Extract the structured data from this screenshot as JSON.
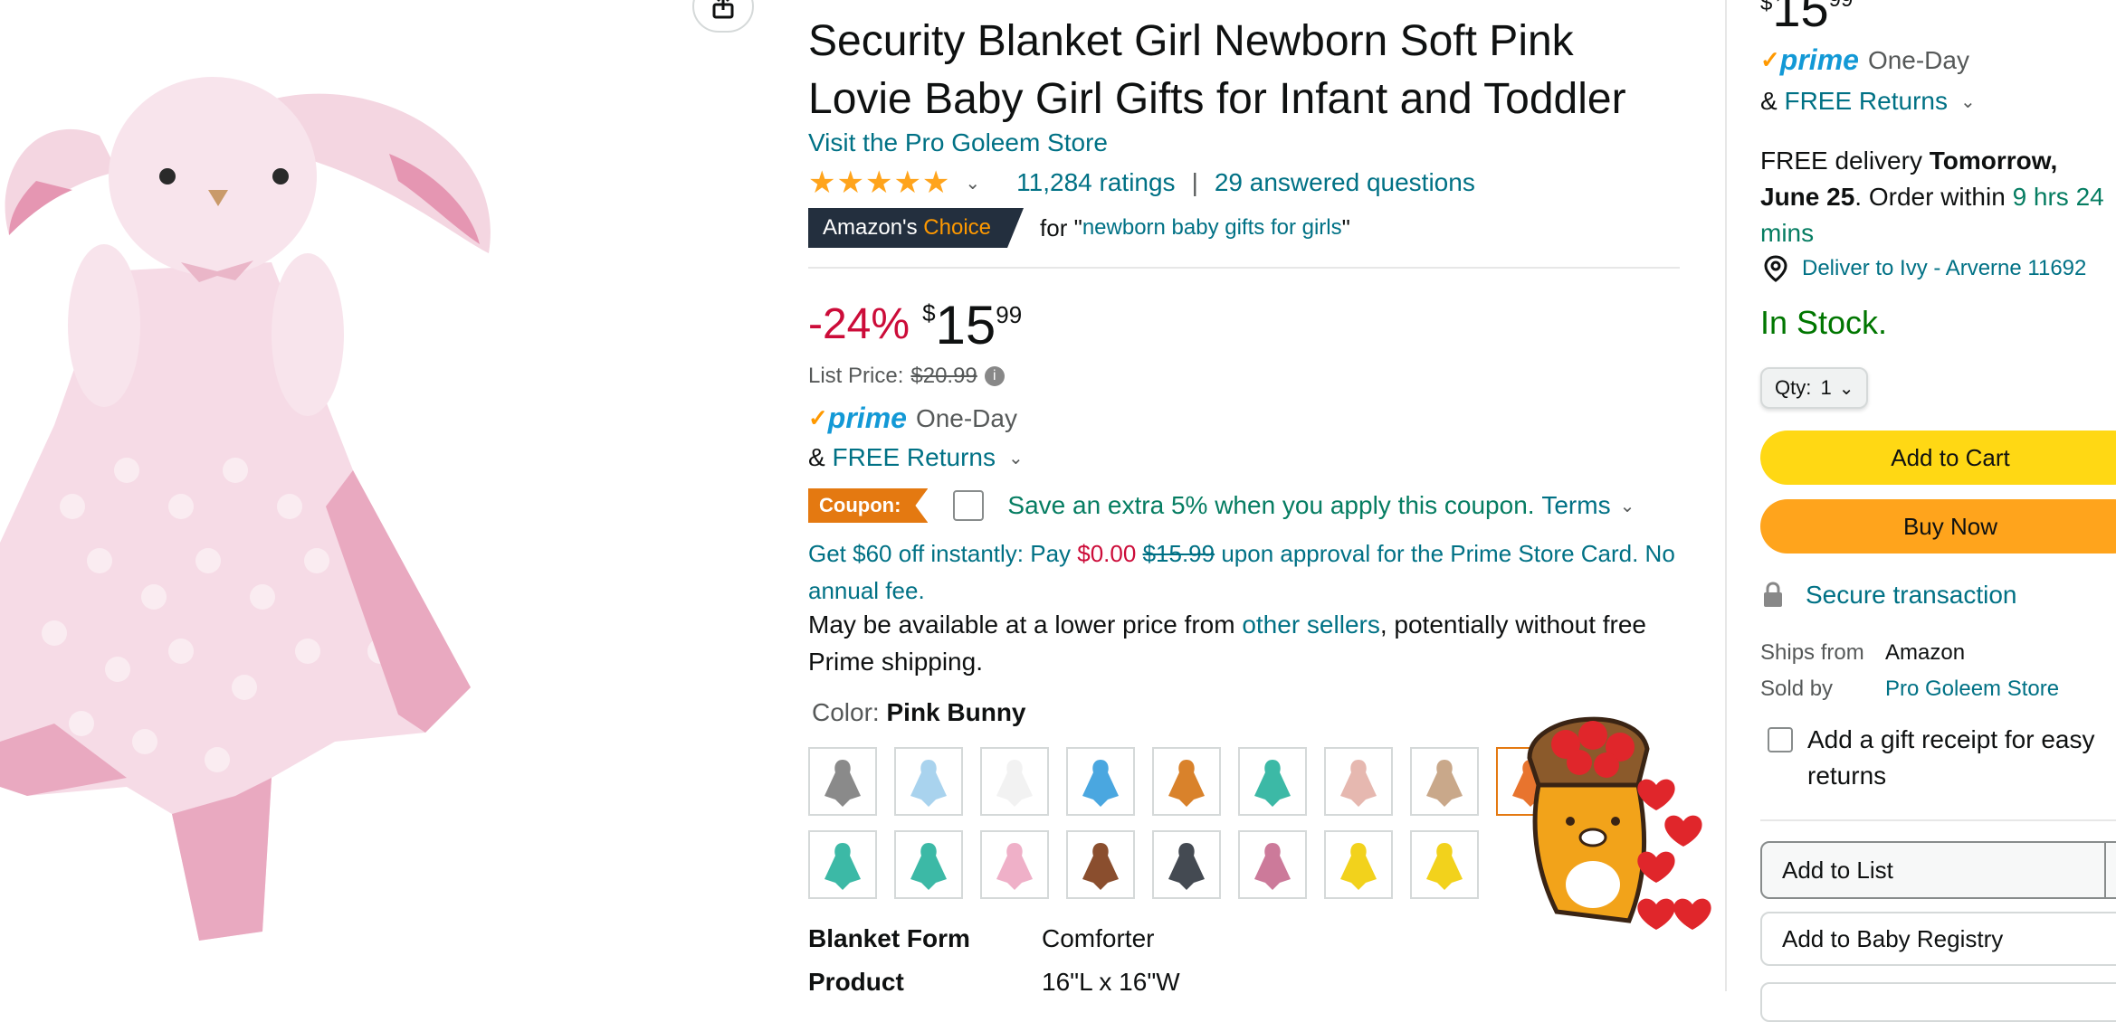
{
  "product": {
    "title_lines": [
      "Security Blanket Girl Newborn Soft Pink",
      "Lovie Baby Girl Gifts for Infant and Toddler"
    ],
    "store_link": "Visit the Pro Goleem Store",
    "stars": "★★★★★",
    "rating_count": "11,284 ratings",
    "separator": "|",
    "answered": "29 answered questions",
    "choice_prefix": "Amazon's",
    "choice_word": "Choice",
    "choice_for": "for \"",
    "choice_query": "newborn baby gifts for girls",
    "choice_close": "\"",
    "discount": "-24%",
    "currency": "$",
    "price_whole": "15",
    "price_fraction": "99",
    "list_price_label": "List Price:",
    "list_price": "$20.99",
    "prime_word": "prime",
    "prime_speed": "One-Day",
    "amp": "&",
    "free_returns": "FREE Returns",
    "coupon_badge": "Coupon:",
    "coupon_text": "Save an extra 5% when you apply this coupon.",
    "coupon_terms": "Terms",
    "card_offer_pre": "Get $60 off instantly: Pay ",
    "card_offer_pay": "$0.00",
    "card_offer_old": "$15.99",
    "card_offer_post": " upon approval for the Prime Store Card. No annual fee.",
    "lower_price_pre": "May be available at a lower price from ",
    "lower_price_link": "other sellers",
    "lower_price_post": ", potentially without free Prime shipping.",
    "color_label": "Color:",
    "color_value": "Pink Bunny",
    "specs": [
      {
        "key": "Blanket Form",
        "value": "Comforter"
      },
      {
        "key": "Product",
        "value": "16\"L x 16\"W"
      }
    ]
  },
  "swatch_colors": [
    "#8a8a8a",
    "#a9d3ee",
    "#f2f2f2",
    "#4aa7e0",
    "#d9822b",
    "#3cb9a6",
    "#e6b8b0",
    "#c9a88a",
    "#e8742e",
    "#3cb9a6",
    "#3cb9a6",
    "#efb0c8",
    "#8a4e2e",
    "#444a52",
    "#cc7a9a",
    "#f2d21c",
    "#f2d21c"
  ],
  "buybox": {
    "currency": "$",
    "price_whole": "15",
    "price_fraction": "99",
    "prime_word": "prime",
    "prime_speed": "One-Day",
    "amp": "&",
    "free_returns": "FREE Returns",
    "delivery_pre": "FREE delivery ",
    "delivery_date": "Tomorrow, June 25",
    "delivery_mid": ". Order within ",
    "delivery_time": "9 hrs 24 mins",
    "deliver_to": "Deliver to Ivy - Arverne 11692",
    "stock": "In Stock.",
    "qty_label": "Qty:",
    "qty_value": "1",
    "add_to_cart": "Add to Cart",
    "buy_now": "Buy Now",
    "secure": "Secure transaction",
    "ships_from_label": "Ships from",
    "ships_from": "Amazon",
    "sold_by_label": "Sold by",
    "sold_by": "Pro Goleem Store",
    "gift_receipt": "Add a gift receipt for easy returns",
    "add_to_list": "Add to List",
    "add_to_registry": "Add to Baby Registry"
  },
  "colors": {
    "link": "#007185",
    "deal_red": "#cc0c39",
    "prime_blue": "#1399d6",
    "cart_yellow": "#ffd814",
    "buy_orange": "#ffa41c",
    "stock_green": "#007600"
  }
}
